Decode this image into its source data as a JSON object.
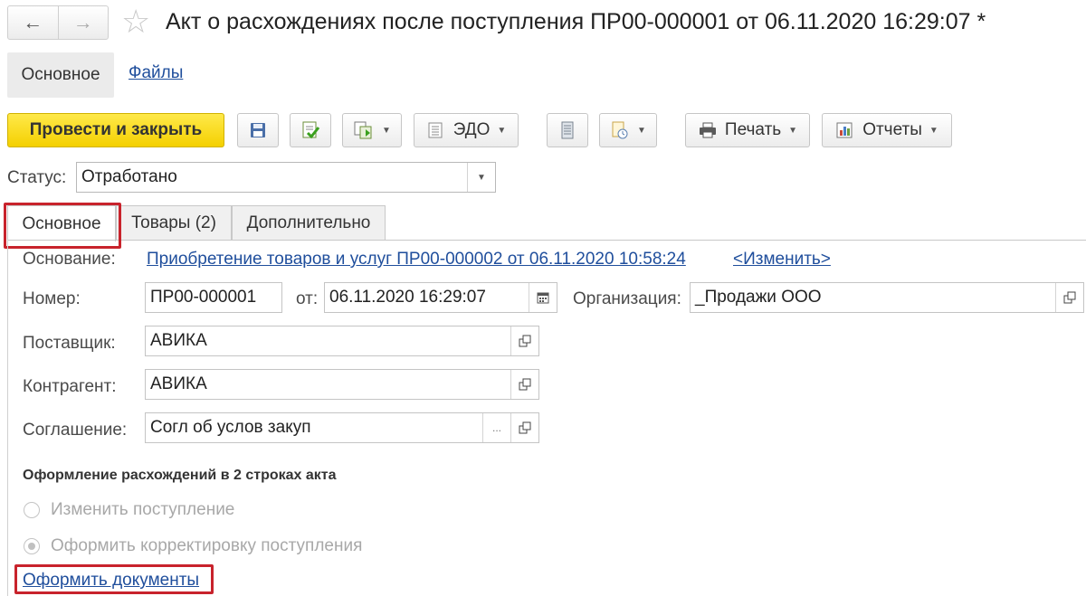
{
  "window": {
    "title": "Акт о расхождениях после поступления ПР00-000001 от 06.11.2020 16:29:07 *",
    "back_icon": "arrow-left",
    "forward_icon": "arrow-right",
    "favorite_icon": "star"
  },
  "section_nav": {
    "main": "Основное",
    "files": "Файлы"
  },
  "toolbar": {
    "post_close": "Провести и закрыть",
    "edo": "ЭДО",
    "print": "Печать",
    "reports": "Отчеты"
  },
  "status": {
    "label": "Статус:",
    "value": "Отработано"
  },
  "tabs": [
    {
      "label": "Основное"
    },
    {
      "label": "Товары (2)"
    },
    {
      "label": "Дополнительно"
    }
  ],
  "form": {
    "basis_label": "Основание:",
    "basis_link": "Приобретение товаров и услуг ПР00-000002 от 06.11.2020 10:58:24",
    "change_link": "<Изменить>",
    "number_label": "Номер:",
    "number_value": "ПР00-000001",
    "date_label": "от:",
    "date_value": "06.11.2020 16:29:07",
    "org_label": "Организация:",
    "org_value": "_Продажи ООО",
    "supplier_label": "Поставщик:",
    "supplier_value": "АВИКА",
    "counterparty_label": "Контрагент:",
    "counterparty_value": "АВИКА",
    "agreement_label": "Соглашение:",
    "agreement_value": "Согл об услов закуп",
    "ellipsis": "..."
  },
  "discrepancy": {
    "heading": "Оформление расхождений в 2 строках акта",
    "option_change": "Изменить поступление",
    "option_correct": "Оформить корректировку поступления",
    "selected": "option_correct",
    "create_docs_link": "Оформить документы"
  },
  "colors": {
    "primary_button": "#f4d000",
    "link": "#1f4e9c",
    "highlight_box": "#c8232c"
  }
}
